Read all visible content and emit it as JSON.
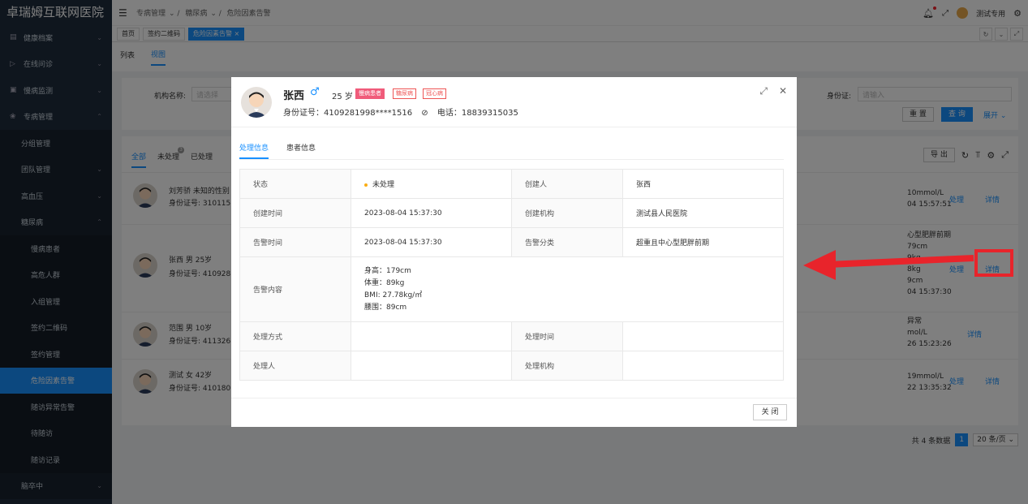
{
  "app": {
    "title": "卓瑞姆互联网医院"
  },
  "sidebar": {
    "items": [
      {
        "label": "健康档案",
        "icon": "file-icon",
        "chevron": "⌄"
      },
      {
        "label": "在线问诊",
        "icon": "send-icon",
        "chevron": "⌄"
      },
      {
        "label": "慢病监测",
        "icon": "monitor-icon",
        "chevron": "⌄"
      },
      {
        "label": "专病管理",
        "icon": "gear-icon",
        "chevron": "⌃"
      },
      {
        "label": "分组管理"
      },
      {
        "label": "团队管理",
        "chevron": "⌄"
      },
      {
        "label": "高血压",
        "chevron": "⌄"
      },
      {
        "label": "糖尿病",
        "chevron": "⌃"
      },
      {
        "label": "慢病患者"
      },
      {
        "label": "高危人群"
      },
      {
        "label": "入组管理"
      },
      {
        "label": "签约二维码"
      },
      {
        "label": "签约管理"
      },
      {
        "label": "危险因素告警"
      },
      {
        "label": "随访异常告警"
      },
      {
        "label": "待随访"
      },
      {
        "label": "随访记录"
      },
      {
        "label": "脑卒中",
        "chevron": "⌄"
      }
    ]
  },
  "header": {
    "breadcrumb": [
      "专病管理",
      "糖尿病",
      "危险因素告警"
    ],
    "user": "测试专用"
  },
  "tabs": [
    {
      "label": "首页"
    },
    {
      "label": "签约二维码"
    },
    {
      "label": "危险因素告警 ×"
    }
  ],
  "view_tabs": [
    "列表",
    "视图"
  ],
  "filter": {
    "org_label": "机构名称:",
    "org_placeholder": "请选择",
    "id_label": "身份证:",
    "id_placeholder": "请输入",
    "reset": "重 置",
    "query": "查 询",
    "expand": "展开 ⌄"
  },
  "status_tabs": {
    "all": "全部",
    "unhandled": "未处理",
    "unhandled_count": "3",
    "handled": "已处理"
  },
  "list_tools": {
    "export": "导 出"
  },
  "rows": [
    {
      "name": "刘芳骄  未知的性别",
      "id": "身份证号: 310115",
      "right1": "10mmol/L",
      "right2": "04 15:57:51",
      "handle": "处理",
      "detail": "详情"
    },
    {
      "name": "张西  男  25岁",
      "id": "身份证号: 410928",
      "right1": "心型肥胖前期",
      "right2": "79cm",
      "right3": "9kg",
      "right4": "8kg",
      "right5": "9cm",
      "right6": "04 15:37:30",
      "handle": "处理",
      "detail": "详情"
    },
    {
      "name": "范围  男  10岁",
      "id": "身份证号: 411326",
      "right1": "异常",
      "right2": "mol/L",
      "right3": "26 15:23:26",
      "detail": "详情"
    },
    {
      "name": "测试  女  42岁",
      "id": "身份证号: 410180",
      "right1": "19mmol/L",
      "right2": "22 13:35:32",
      "handle": "处理",
      "detail": "详情"
    }
  ],
  "pager": {
    "total": "共 4 条数据",
    "page": "1",
    "size": "20 条/页 ⌄"
  },
  "modal": {
    "name": "张西",
    "sex": "♂",
    "age": "25 岁",
    "tags": [
      "慢病患者",
      "糖尿病",
      "冠心病"
    ],
    "id_line": "身份证号：4109281998****1516",
    "phone": "电话：18839315035",
    "tabs": [
      "处理信息",
      "患者信息"
    ],
    "table": {
      "status_label": "状态",
      "status_value": "未处理",
      "creator_label": "创建人",
      "creator_value": "张西",
      "create_time_label": "创建时间",
      "create_time_value": "2023-08-04 15:37:30",
      "create_org_label": "创建机构",
      "create_org_value": "测试县人民医院",
      "alarm_time_label": "告警时间",
      "alarm_time_value": "2023-08-04 15:37:30",
      "alarm_type_label": "告警分类",
      "alarm_type_value": "超重且中心型肥胖前期",
      "content_label": "告警内容",
      "content_lines": [
        "身高：179cm",
        "体重：89kg",
        "BMI: 27.78kg/㎡",
        "腰围：89cm"
      ],
      "method_label": "处理方式",
      "handle_time_label": "处理时间",
      "handler_label": "处理人",
      "handle_org_label": "处理机构"
    },
    "close": "关 闭"
  },
  "colors": {
    "accent": "#1890ff",
    "sidebar": "#1f2d3d",
    "annotation": "#e8242b"
  }
}
